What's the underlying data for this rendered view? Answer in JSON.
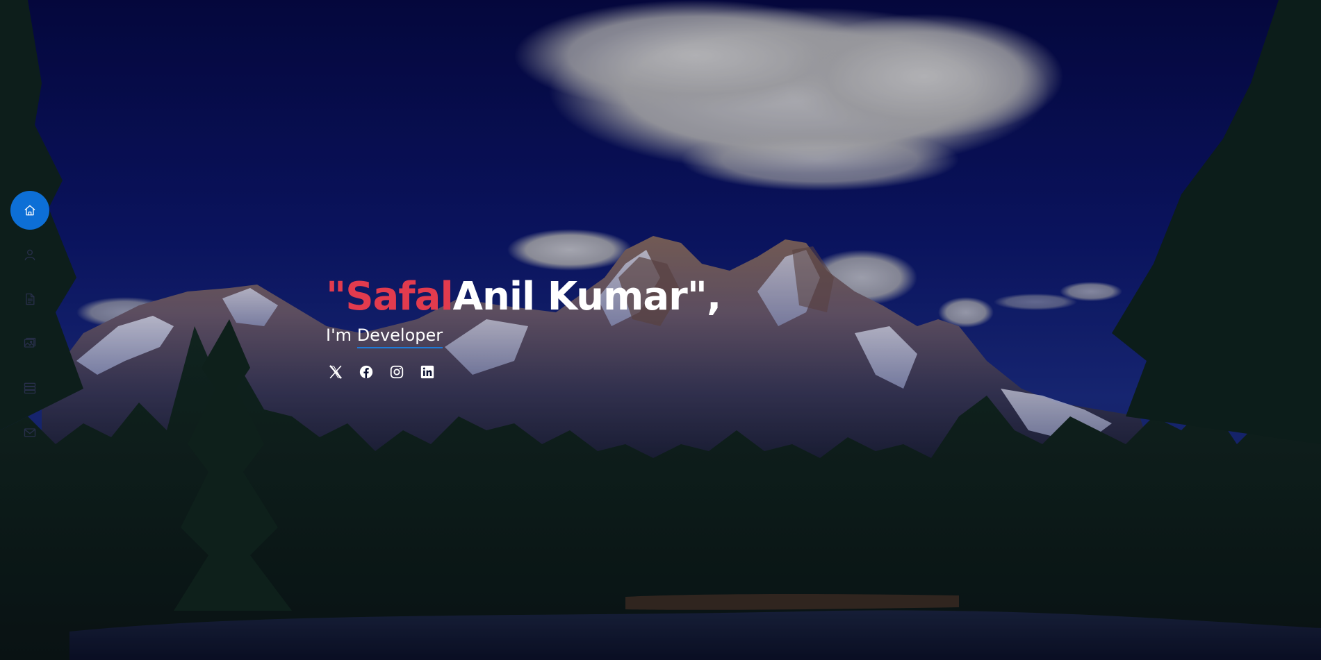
{
  "hero": {
    "name_quote_open": "\"",
    "name_first": "Safal",
    "name_rest": "Anil Kumar\",",
    "subtitle_prefix": "I'm",
    "typed_role": "Developer"
  },
  "sidenav": {
    "items": [
      {
        "icon": "house-icon",
        "active": true
      },
      {
        "icon": "person-icon",
        "active": false
      },
      {
        "icon": "file-text-icon",
        "active": false
      },
      {
        "icon": "images-icon",
        "active": false
      },
      {
        "icon": "server-icon",
        "active": false
      },
      {
        "icon": "envelope-icon",
        "active": false
      }
    ]
  },
  "socials": [
    "x-twitter-icon",
    "facebook-icon",
    "instagram-icon",
    "linkedin-icon"
  ],
  "colors": {
    "accent_name": "#e23b4e",
    "nav_active": "#0d6fd6",
    "typed_underline": "#1e7bd8",
    "overlay": "#040830"
  }
}
